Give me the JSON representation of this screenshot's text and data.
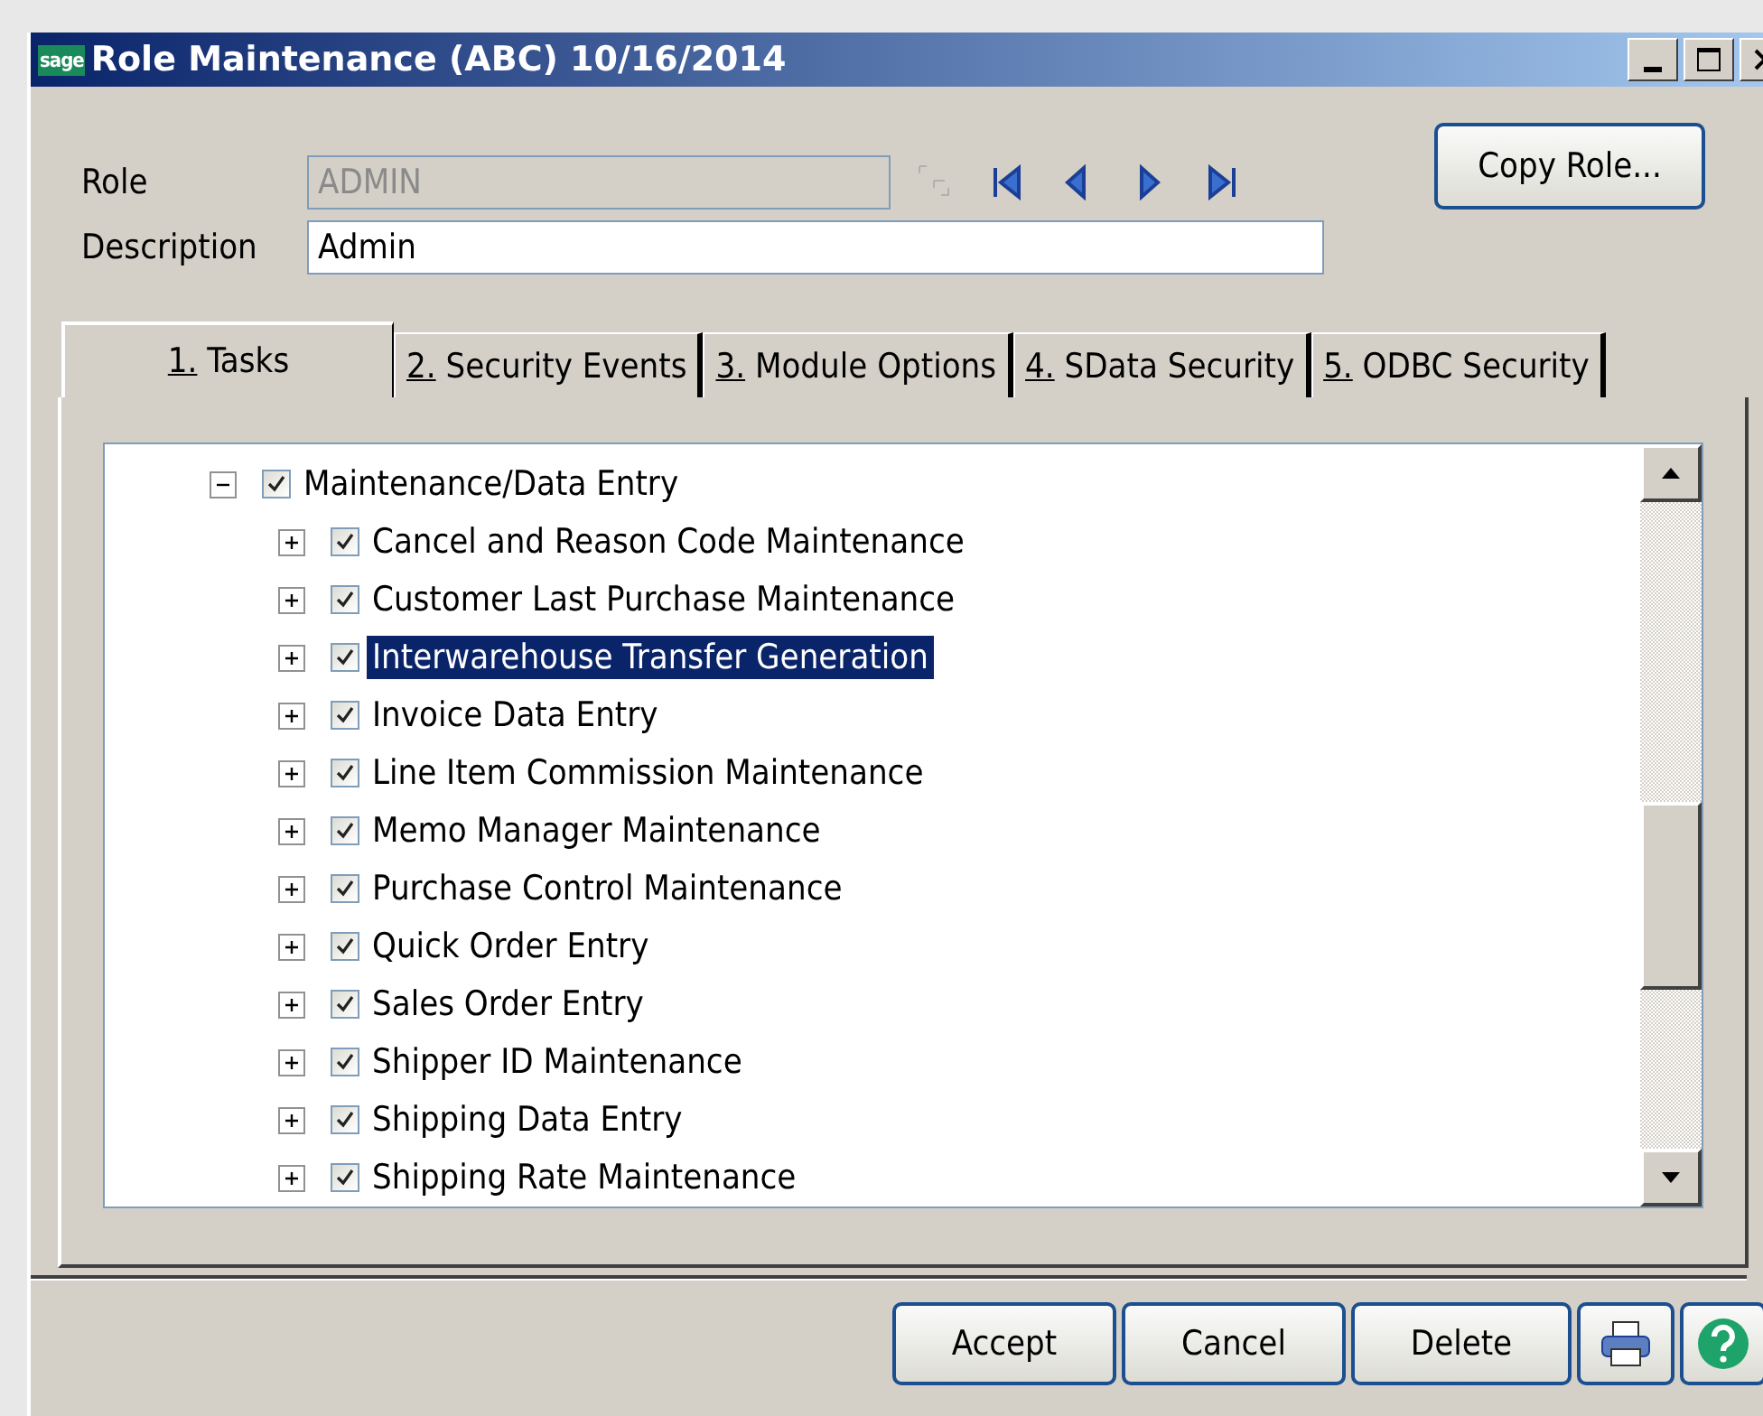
{
  "window": {
    "logo": "sage",
    "title": "Role Maintenance (ABC) 10/16/2014"
  },
  "role": {
    "label": "Role",
    "value": "ADMIN",
    "disabled": true
  },
  "description": {
    "label": "Description",
    "value": "Admin"
  },
  "copy_role_button": "Copy Role...",
  "tabs": [
    {
      "label": "1. Tasks",
      "selected": true
    },
    {
      "label": "2. Security Events",
      "selected": false
    },
    {
      "label": "3. Module Options",
      "selected": false
    },
    {
      "label": "4. SData Security",
      "selected": false
    },
    {
      "label": "5. ODBC Security",
      "selected": false
    }
  ],
  "tree": [
    {
      "label": "Maintenance/Data Entry",
      "checked": true,
      "expanded": true,
      "selected": false,
      "children": [
        {
          "label": "Cancel and Reason Code Maintenance",
          "checked": true,
          "expanded": false,
          "selected": false
        },
        {
          "label": "Customer Last Purchase Maintenance",
          "checked": true,
          "expanded": false,
          "selected": false
        },
        {
          "label": "Interwarehouse Transfer Generation",
          "checked": true,
          "expanded": false,
          "selected": true
        },
        {
          "label": "Invoice Data Entry",
          "checked": true,
          "expanded": false,
          "selected": false
        },
        {
          "label": "Line Item Commission Maintenance",
          "checked": true,
          "expanded": false,
          "selected": false
        },
        {
          "label": "Memo Manager Maintenance",
          "checked": true,
          "expanded": false,
          "selected": false
        },
        {
          "label": "Purchase Control Maintenance",
          "checked": true,
          "expanded": false,
          "selected": false
        },
        {
          "label": "Quick Order Entry",
          "checked": true,
          "expanded": false,
          "selected": false
        },
        {
          "label": "Sales Order Entry",
          "checked": true,
          "expanded": false,
          "selected": false
        },
        {
          "label": "Shipper ID Maintenance",
          "checked": true,
          "expanded": false,
          "selected": false
        },
        {
          "label": "Shipping Data Entry",
          "checked": true,
          "expanded": false,
          "selected": false
        },
        {
          "label": "Shipping Rate Maintenance",
          "checked": true,
          "expanded": false,
          "selected": false
        }
      ]
    }
  ],
  "buttons": [
    "Accept",
    "Cancel",
    "Delete"
  ]
}
